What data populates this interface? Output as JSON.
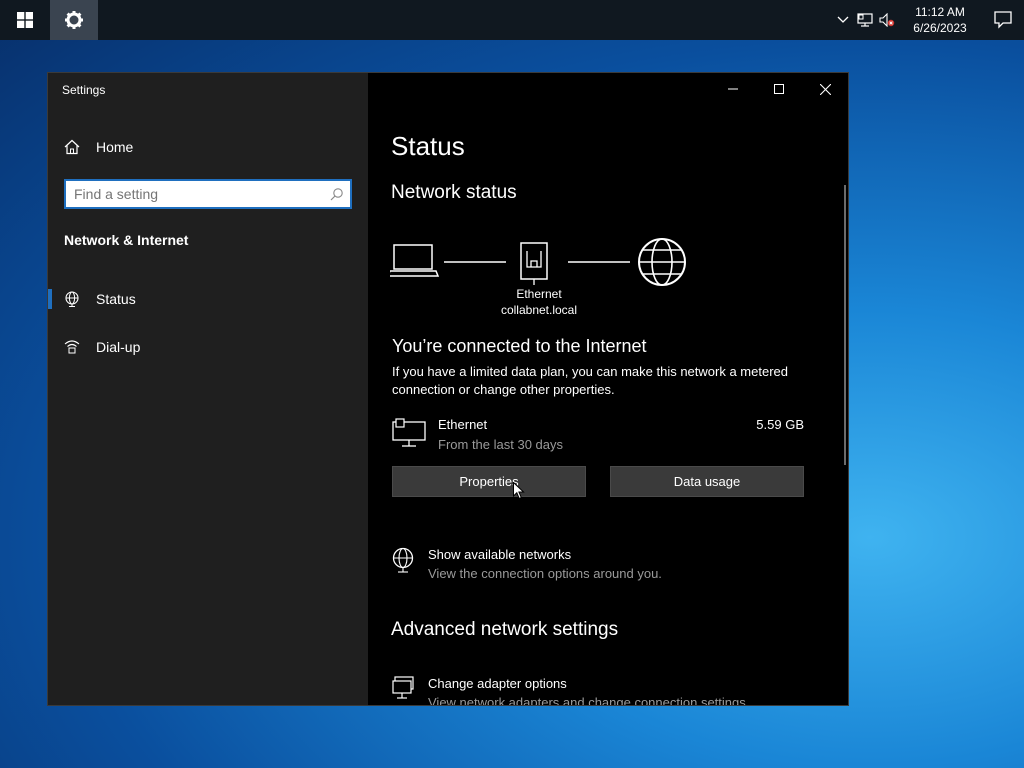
{
  "taskbar": {
    "start_icon": "windows-logo-icon",
    "pinned_app_icon": "gear-icon",
    "tray_icons": [
      "chevron-up-icon",
      "network-icon",
      "volume-muted-icon"
    ],
    "time": "11:12 AM",
    "date": "6/26/2023",
    "notification_icon": "action-center-icon"
  },
  "window": {
    "title": "Settings",
    "controls": [
      "minimize-icon",
      "maximize-icon",
      "close-icon"
    ]
  },
  "sidebar": {
    "home_label": "Home",
    "search_placeholder": "Find a setting",
    "section_title": "Network & Internet",
    "items": [
      {
        "label": "Status",
        "icon": "globe-icon",
        "selected": true
      },
      {
        "label": "Dial-up",
        "icon": "dialup-icon",
        "selected": false
      }
    ]
  },
  "content": {
    "page_title": "Status",
    "network_status_heading": "Network status",
    "diagram": {
      "adapter_label": "Ethernet",
      "network_label": "collabnet.local"
    },
    "connected_heading": "You’re connected to the Internet",
    "connected_desc": "If you have a limited data plan, you can make this network a metered connection or change other properties.",
    "connection": {
      "name": "Ethernet",
      "subtitle": "From the last 30 days",
      "usage": "5.59 GB"
    },
    "buttons": {
      "properties": "Properties",
      "data_usage": "Data usage"
    },
    "show_networks": {
      "title": "Show available networks",
      "desc": "View the connection options around you."
    },
    "advanced_heading": "Advanced network settings",
    "change_adapter": {
      "title": "Change adapter options",
      "desc": "View network adapters and change connection settings."
    }
  },
  "colors": {
    "accent": "#1f6fbf",
    "sidebar_bg": "#1f1f1f",
    "content_bg": "#000000",
    "button_bg": "#3a3a3a",
    "secondary_text": "#9a9a9a"
  }
}
